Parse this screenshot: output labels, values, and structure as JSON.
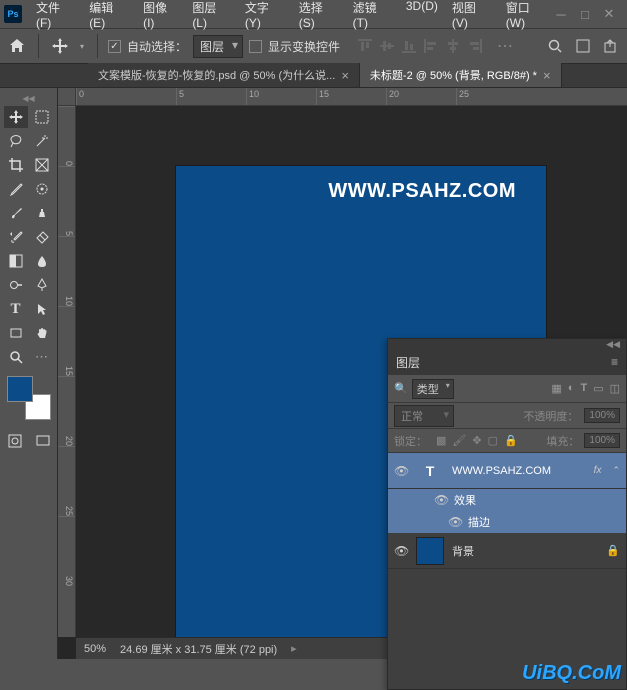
{
  "app": {
    "logo": "Ps"
  },
  "menu": [
    "文件(F)",
    "编辑(E)",
    "图像(I)",
    "图层(L)",
    "文字(Y)",
    "选择(S)",
    "滤镜(T)",
    "3D(D)",
    "视图(V)",
    "窗口(W)"
  ],
  "options": {
    "auto_select": "自动选择：",
    "target": "图层",
    "show_transform": "显示变换控件"
  },
  "tabs": [
    {
      "title": "文案模版-恢复的-恢复的.psd @ 50% (为什么说...",
      "active": false
    },
    {
      "title": "未标题-2 @ 50% (背景, RGB/8#) *",
      "active": true
    }
  ],
  "ruler_h": [
    "0",
    "5",
    "10",
    "15",
    "20",
    "25"
  ],
  "ruler_v": [
    "0",
    "5",
    "10",
    "15",
    "20",
    "25",
    "30"
  ],
  "document": {
    "text": "WWW.PSAHZ.COM"
  },
  "status": {
    "zoom": "50%",
    "dims": "24.69 厘米 x 31.75 厘米 (72 ppi)"
  },
  "layers_panel": {
    "title": "图层",
    "filter_type": "类型",
    "blend_mode": "正常",
    "opacity_label": "不透明度：",
    "opacity_value": "100%",
    "lock_label": "锁定：",
    "fill_label": "填充：",
    "fill_value": "100%",
    "layers": [
      {
        "name": "WWW.PSAHZ.COM",
        "type": "text",
        "fx": "fx",
        "effects_label": "效果",
        "stroke_label": "描边"
      },
      {
        "name": "背景",
        "type": "bg",
        "locked": true
      }
    ]
  },
  "watermark": "UiBQ.CoM",
  "colors": {
    "canvas_bg": "#0b4b87"
  }
}
